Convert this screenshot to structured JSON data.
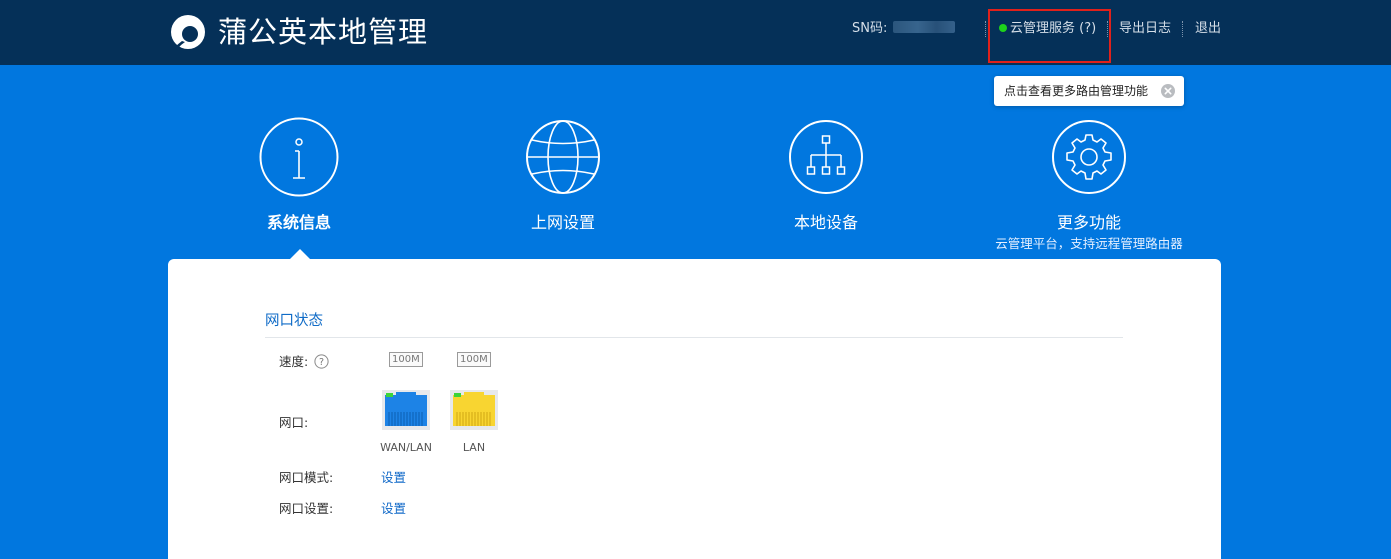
{
  "header": {
    "title": "蒲公英本地管理",
    "sn_label": "SN码:",
    "cloud_service": {
      "label": "云管理服务 (?)",
      "status_color": "#1ed21b"
    },
    "export_log": "导出日志",
    "logout": "退出",
    "logo_icon": "dandelion-logo-icon"
  },
  "tooltip": {
    "text": "点击查看更多路由管理功能",
    "close_icon": "close-circle-icon"
  },
  "nav": {
    "items": [
      {
        "label": "系统信息",
        "icon": "info-icon",
        "active": true
      },
      {
        "label": "上网设置",
        "icon": "globe-icon"
      },
      {
        "label": "本地设备",
        "icon": "network-topology-icon"
      },
      {
        "label": "更多功能",
        "icon": "gear-icon",
        "sub": "云管理平台，支持远程管理路由器"
      }
    ]
  },
  "panel": {
    "section_title": "网口状态",
    "speed_label": "速度:",
    "port_label": "网口:",
    "port_mode_label": "网口模式:",
    "port_settings_label": "网口设置:",
    "settings_link": "设置",
    "ports": [
      {
        "name": "WAN/LAN",
        "speed": "100M",
        "color": "#1d83e6"
      },
      {
        "name": "LAN",
        "speed": "100M",
        "color": "#f8d531"
      }
    ]
  },
  "colors": {
    "header_bg": "#053058",
    "page_bg": "#0177df",
    "accent": "#1169c8",
    "highlight_border": "#e0211b"
  }
}
